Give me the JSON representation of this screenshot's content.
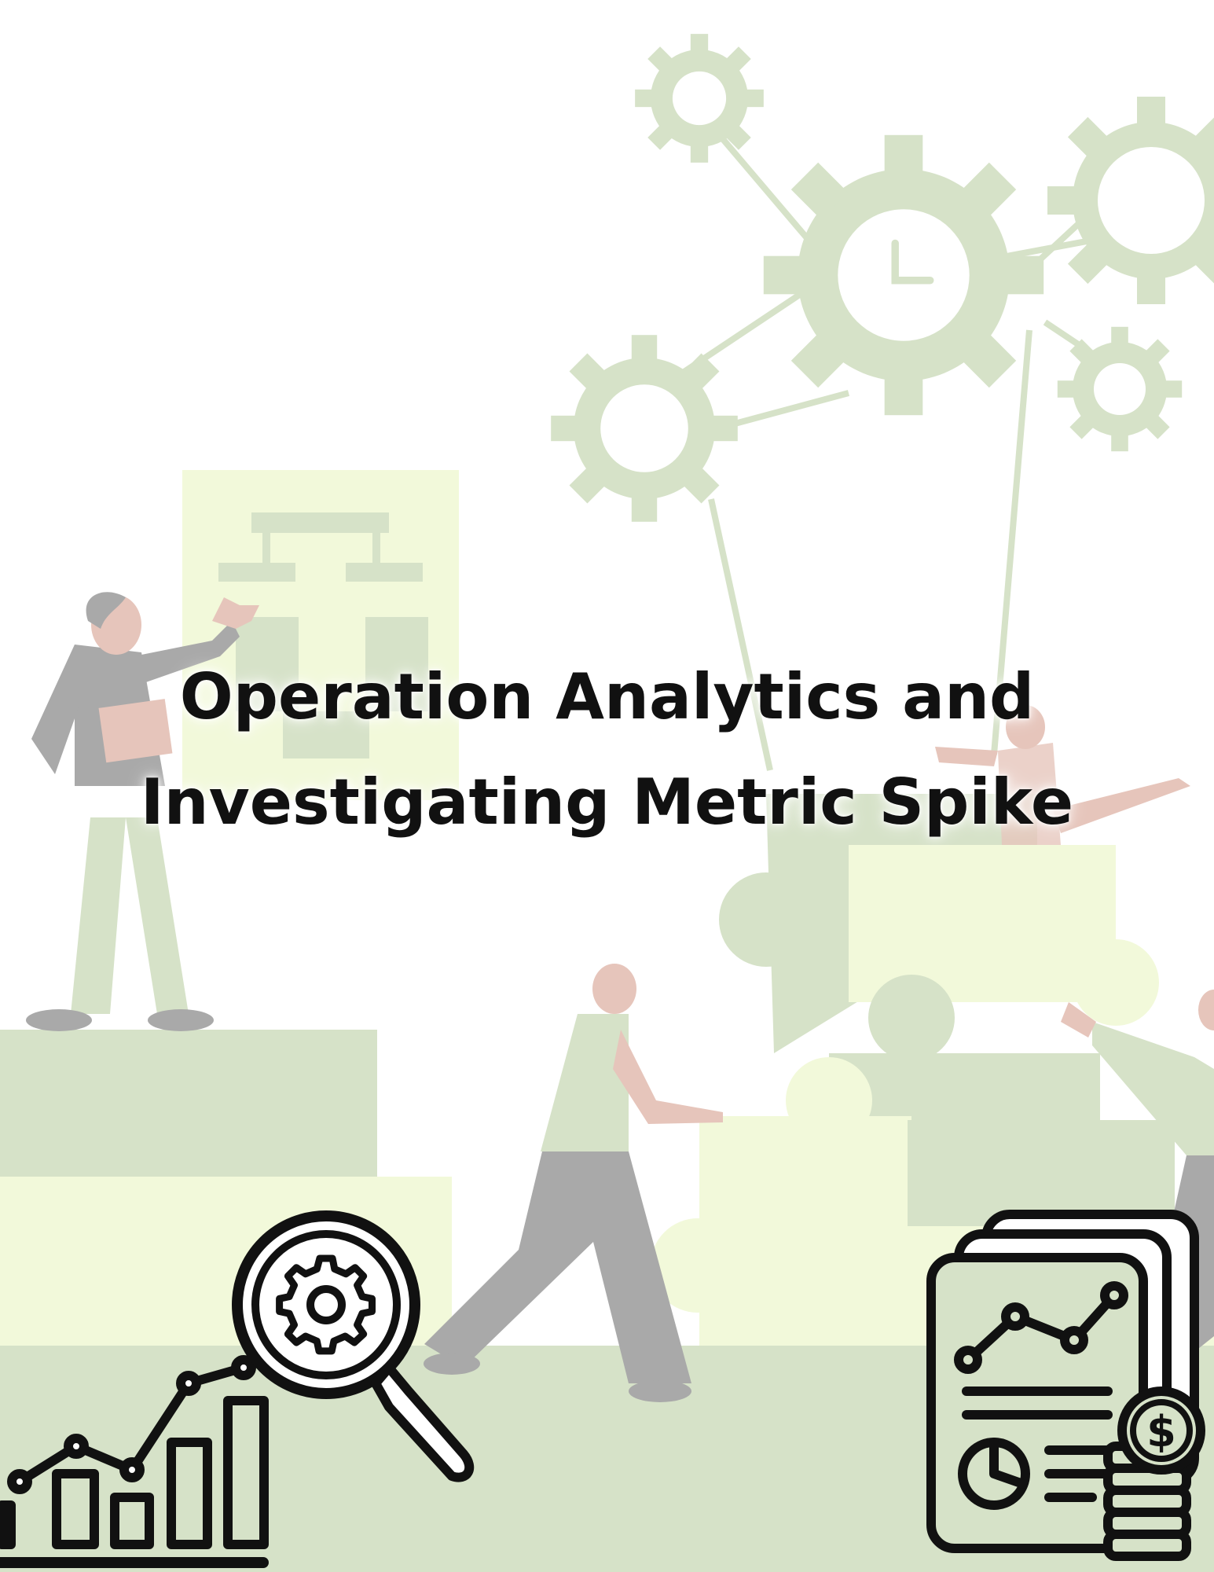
{
  "cover": {
    "title_line_1": "Operation Analytics and",
    "title_line_2": "Investigating Metric Spike"
  },
  "icons": {
    "background": [
      "gear-cluster-illustration",
      "org-chart-board",
      "puzzle-pieces",
      "team-people-illustration"
    ],
    "foreground": [
      "bar-chart-magnifier-gear-icon",
      "financial-report-coins-icon"
    ]
  },
  "colors": {
    "sage_green": "#d6e2c8",
    "pale_lime": "#f2f9da",
    "gray": "#a9a9a9",
    "skin": "#e6c5bb",
    "ink": "#111111"
  }
}
